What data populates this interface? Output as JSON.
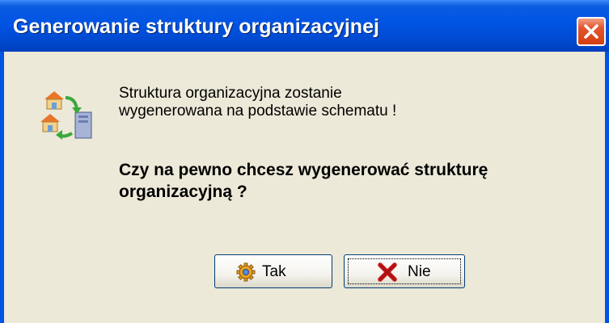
{
  "window": {
    "title": "Generowanie struktury organizacyjnej",
    "close_icon": "close-icon"
  },
  "dialog": {
    "icon": "organization-structure-icon",
    "message_lines": [
      "Struktura organizacyjna zostanie",
      "wygenerowana na podstawie schematu !"
    ],
    "question": "Czy na pewno chcesz wygenerować strukturę organizacyjną ?"
  },
  "buttons": {
    "yes": {
      "label": "Tak",
      "icon": "gear-icon"
    },
    "no": {
      "label": "Nie",
      "icon": "x-icon"
    }
  },
  "colors": {
    "titlebar": "#0054e3",
    "dialog_background": "#ece9d8",
    "close_button": "#d43e12"
  }
}
